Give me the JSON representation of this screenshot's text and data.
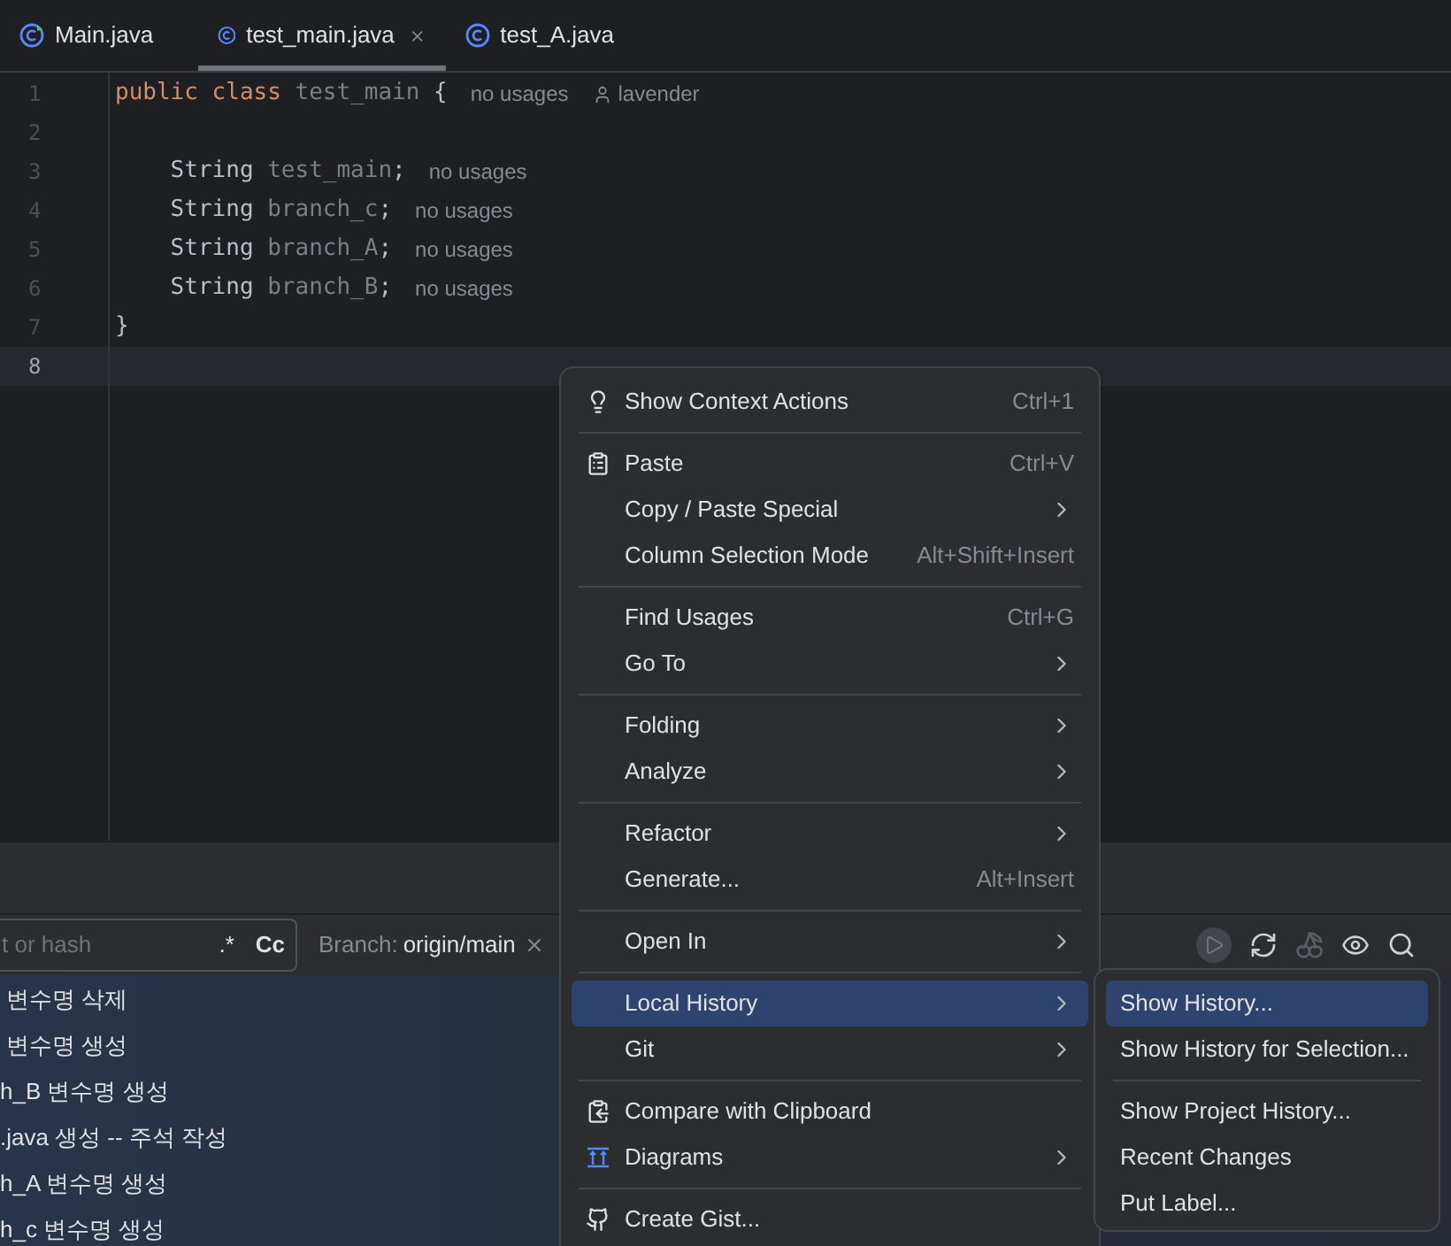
{
  "tabs": [
    {
      "label": "Main.java",
      "kind": "main",
      "selected": false
    },
    {
      "label": "test_main.java",
      "kind": "class",
      "selected": true
    },
    {
      "label": "test_A.java",
      "kind": "class",
      "selected": false
    }
  ],
  "editor": {
    "lines": [
      {
        "number": "1",
        "current": false,
        "tokens": [
          {
            "text": "public ",
            "kind": "keyword"
          },
          {
            "text": "class ",
            "kind": "keyword"
          },
          {
            "text": "test_main ",
            "kind": "unused"
          },
          {
            "text": "{",
            "kind": "plain"
          }
        ],
        "hints": [
          {
            "text": "no usages",
            "kind": "usages"
          },
          {
            "text": "lavender",
            "kind": "author"
          }
        ]
      },
      {
        "number": "2",
        "current": false
      },
      {
        "number": "3",
        "current": false,
        "tokens": [
          {
            "text": "    String ",
            "kind": "type"
          },
          {
            "text": "test_main",
            "kind": "unused"
          },
          {
            "text": ";",
            "kind": "plain"
          }
        ],
        "hints": [
          {
            "text": "no usages",
            "kind": "usages"
          }
        ]
      },
      {
        "number": "4",
        "current": false,
        "tokens": [
          {
            "text": "    String ",
            "kind": "type"
          },
          {
            "text": "branch_c",
            "kind": "unused"
          },
          {
            "text": ";",
            "kind": "plain"
          }
        ],
        "hints": [
          {
            "text": "no usages",
            "kind": "usages"
          }
        ]
      },
      {
        "number": "5",
        "current": false,
        "tokens": [
          {
            "text": "    String ",
            "kind": "type"
          },
          {
            "text": "branch_A",
            "kind": "unused"
          },
          {
            "text": ";",
            "kind": "plain"
          }
        ],
        "hints": [
          {
            "text": "no usages",
            "kind": "usages"
          }
        ]
      },
      {
        "number": "6",
        "current": false,
        "tokens": [
          {
            "text": "    String ",
            "kind": "type"
          },
          {
            "text": "branch_B",
            "kind": "unused"
          },
          {
            "text": ";",
            "kind": "plain"
          }
        ],
        "hints": [
          {
            "text": "no usages",
            "kind": "usages"
          }
        ]
      },
      {
        "number": "7",
        "current": false,
        "tokens": [
          {
            "text": "}",
            "kind": "plain"
          }
        ]
      },
      {
        "number": "8",
        "current": true
      }
    ]
  },
  "git_log": {
    "search": {
      "placeholder": "t or hash",
      "regex": ".*",
      "match_case": "Cc"
    },
    "branch_filter": {
      "label": "Branch:",
      "value": "origin/main"
    },
    "toolbar": [
      {
        "kind": "play",
        "disabled": true
      },
      {
        "kind": "refresh",
        "disabled": false
      },
      {
        "kind": "cherry",
        "disabled": true
      },
      {
        "kind": "eye",
        "disabled": false
      },
      {
        "kind": "search",
        "disabled": false
      }
    ],
    "commits": [
      " 변수명 삭제",
      " 변수명 생성",
      "h_B 변수명 생성",
      ".java 생성 -- 주석 작성",
      "h_A 변수명 생성",
      "h_c 변수명 생성"
    ]
  },
  "context_menu": {
    "items": [
      {
        "kind": "bulb",
        "label": "Show Context Actions",
        "shortcut": "Ctrl+1",
        "submenu": false,
        "selected": false
      },
      {
        "kind": "separator"
      },
      {
        "kind": "clipboard",
        "label": "Paste",
        "shortcut": "Ctrl+V",
        "submenu": false,
        "selected": false
      },
      {
        "kind": "plain",
        "label": "Copy / Paste Special",
        "submenu": true,
        "selected": false
      },
      {
        "kind": "plain",
        "label": "Column Selection Mode",
        "shortcut": "Alt+Shift+Insert",
        "submenu": false,
        "selected": false
      },
      {
        "kind": "separator"
      },
      {
        "kind": "plain",
        "label": "Find Usages",
        "shortcut": "Ctrl+G",
        "submenu": false,
        "selected": false
      },
      {
        "kind": "plain",
        "label": "Go To",
        "submenu": true,
        "selected": false
      },
      {
        "kind": "separator"
      },
      {
        "kind": "plain",
        "label": "Folding",
        "submenu": true,
        "selected": false
      },
      {
        "kind": "plain",
        "label": "Analyze",
        "submenu": true,
        "selected": false
      },
      {
        "kind": "separator"
      },
      {
        "kind": "plain",
        "label": "Refactor",
        "submenu": true,
        "selected": false
      },
      {
        "kind": "plain",
        "label": "Generate...",
        "shortcut": "Alt+Insert",
        "submenu": false,
        "selected": false
      },
      {
        "kind": "separator"
      },
      {
        "kind": "plain",
        "label": "Open In",
        "submenu": true,
        "selected": false
      },
      {
        "kind": "separator"
      },
      {
        "kind": "plain",
        "label": "Local History",
        "submenu": true,
        "selected": true
      },
      {
        "kind": "plain",
        "label": "Git",
        "submenu": true,
        "selected": false
      },
      {
        "kind": "separator"
      },
      {
        "kind": "compare",
        "label": "Compare with Clipboard",
        "submenu": false,
        "selected": false
      },
      {
        "kind": "diagram",
        "label": "Diagrams",
        "submenu": true,
        "selected": false
      },
      {
        "kind": "separator"
      },
      {
        "kind": "github",
        "label": "Create Gist...",
        "submenu": false,
        "selected": false
      }
    ]
  },
  "submenu": {
    "items": [
      {
        "kind": "plain",
        "label": "Show History...",
        "selected": true
      },
      {
        "kind": "plain",
        "label": "Show History for Selection...",
        "selected": false
      },
      {
        "kind": "separator"
      },
      {
        "kind": "plain",
        "label": "Show Project History...",
        "selected": false
      },
      {
        "kind": "plain",
        "label": "Recent Changes",
        "selected": false
      },
      {
        "kind": "plain",
        "label": "Put Label...",
        "selected": false
      }
    ]
  }
}
